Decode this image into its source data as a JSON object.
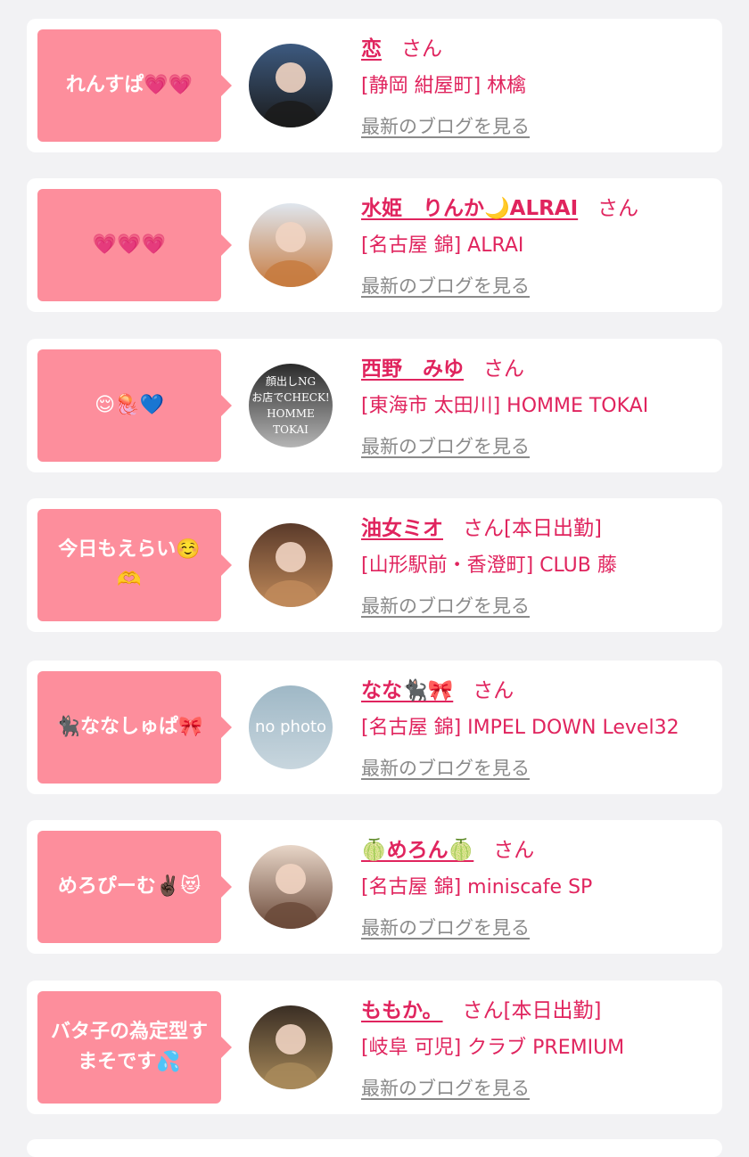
{
  "list": {
    "blog_link_label": "最新のブログを見る",
    "san_label": "さん",
    "items": [
      {
        "comment": "れんすぱ💗💗",
        "name": "恋",
        "suffix": "",
        "shop": "[静岡 紺屋町] 林檎",
        "avatar_icon": "photo-avatar",
        "avatar_colors": [
          "#3d5a80",
          "#1b1b1b"
        ]
      },
      {
        "comment": "💗💗💗",
        "name": "水姫　りんか🌙ALRAI",
        "suffix": "",
        "shop": "[名古屋 錦] ALRAI",
        "avatar_icon": "photo-avatar",
        "avatar_colors": [
          "#dfe6ee",
          "#c77b40"
        ]
      },
      {
        "comment": "😌🪼💙",
        "name": "西野　みゆ",
        "suffix": "",
        "shop": "[東海市 太田川] HOMME TOKAI",
        "avatar_icon": "photo-avatar",
        "avatar_colors": [
          "#2a2a2a",
          "#b5b5b5"
        ],
        "avatar_text": [
          "顔出しNG",
          "お店でCHECK!",
          "HOMME TOKAI"
        ]
      },
      {
        "comment": "今日もえらい☺️🫶",
        "name": "油女ミオ",
        "suffix": "[本日出勤]",
        "shop": "[山形駅前・香澄町] CLUB 藤",
        "avatar_icon": "photo-avatar",
        "avatar_colors": [
          "#5a3a2a",
          "#c08a5a"
        ]
      },
      {
        "comment": "🐈‍⬛ななしゅぱ🎀",
        "name": "なな🐈‍⬛🎀",
        "suffix": "",
        "shop": "[名古屋 錦] IMPEL DOWN Level32",
        "avatar_icon": "no-photo-avatar",
        "avatar_colors": [
          "#9fb8c6",
          "#c8d6de"
        ],
        "avatar_text": [
          "no photo"
        ]
      },
      {
        "comment": "めろぴーむ✌🏿😻",
        "name": "🍈めろん🍈",
        "suffix": "",
        "shop": "[名古屋 錦] miniscafe SP",
        "avatar_icon": "photo-avatar",
        "avatar_colors": [
          "#e8d6c8",
          "#6b4a3a"
        ]
      },
      {
        "comment": "バタ子の為定型すまそです💦",
        "name": "ももか。",
        "suffix": "[本日出勤]",
        "shop": "[岐阜 可児] クラブ PREMIUM",
        "avatar_icon": "photo-avatar",
        "avatar_colors": [
          "#3a2e24",
          "#a88a5a"
        ]
      }
    ]
  }
}
